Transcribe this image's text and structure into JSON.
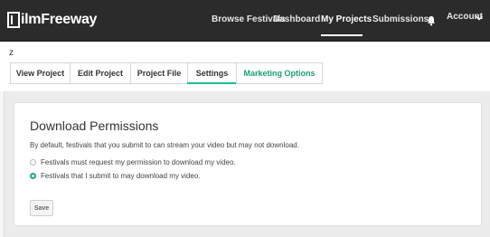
{
  "brand": {
    "name": "FilmFreeway",
    "logo_letter": "F",
    "logo_rest": "ilmFreeway"
  },
  "nav": {
    "browse_festivals": "Browse Festivals",
    "dashboard": "Dashboard",
    "my_projects": "My Projects",
    "submissions": "Submissions",
    "account": "Account",
    "active_item": "My Projects",
    "icons": [
      "bell-icon",
      "chevron-down-icon"
    ]
  },
  "project": {
    "name": "z"
  },
  "tabs": [
    {
      "label": "View Project"
    },
    {
      "label": "Edit Project"
    },
    {
      "label": "Project File"
    },
    {
      "label": "Settings"
    },
    {
      "label": "Marketing Options"
    }
  ],
  "active_tab": "Settings",
  "download_permissions": {
    "title": "Download Permissions",
    "description": "By default, festivals that you submit to can stream your video but may not download.",
    "options": [
      {
        "label": "Festivals must request my permission to download my video.",
        "selected": false
      },
      {
        "label": "Festivals that I submit to may download my video.",
        "selected": true
      }
    ],
    "save_label": "Save"
  },
  "colors": {
    "nav_bg": "#2b2b2b",
    "accent": "#1cbe8f",
    "accent_text": "#1a9f77",
    "page_bg": "#ececec"
  }
}
